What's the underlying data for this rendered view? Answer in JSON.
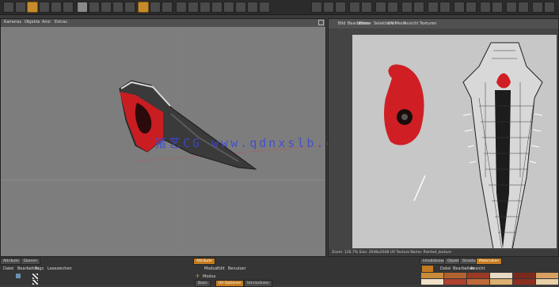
{
  "left_viewport": {
    "menu": [
      "Kameras",
      "Objekte",
      "Ansi",
      "Extras"
    ]
  },
  "uv_editor": {
    "menu": [
      "Bild",
      "Bearbeiten",
      "Ebene",
      "Selektieren",
      "UV Mesh",
      "Ansicht",
      "Texturen"
    ],
    "status": "Zoom: 126.7%   Size: 2048x2048   UV   Texture Name: Painted_texture"
  },
  "bottom_left": {
    "tabs": [
      "Attribute",
      "Ebenen"
    ],
    "menu": [
      "Datei",
      "Bearbeiten",
      "Tags",
      "Lesezeichen"
    ]
  },
  "bottom_middle": {
    "header": "Attribute",
    "menu": [
      "Modus",
      "Edit",
      "Benutzer"
    ],
    "item": "Modus",
    "sub_tabs": [
      "Basis",
      "UV Optionen",
      "Umrisslinien"
    ]
  },
  "bottom_right": {
    "tabs": [
      "Inhaltsbrowser",
      "Objekte",
      "Struktur",
      "Materialien"
    ],
    "menu": [
      "Datei",
      "Bearbeiten",
      "Ansicht"
    ],
    "swatch_colors": [
      "#c98a3a",
      "#b2622e",
      "#9a3a24",
      "#e8d9c4",
      "#7a2a1c",
      "#d8a060",
      "#f0e2c8",
      "#b04030",
      "#c06a3a",
      "#ddb070",
      "#8c2f20",
      "#e9d0a8"
    ]
  },
  "watermark": "猪艺CG www.qdnxslb.cn",
  "colors": {
    "accent": "#c47a1e",
    "viewport_bg": "#7d7d7d",
    "uv_bg": "#c7c7c7",
    "mesh_red": "#cf1f24"
  }
}
